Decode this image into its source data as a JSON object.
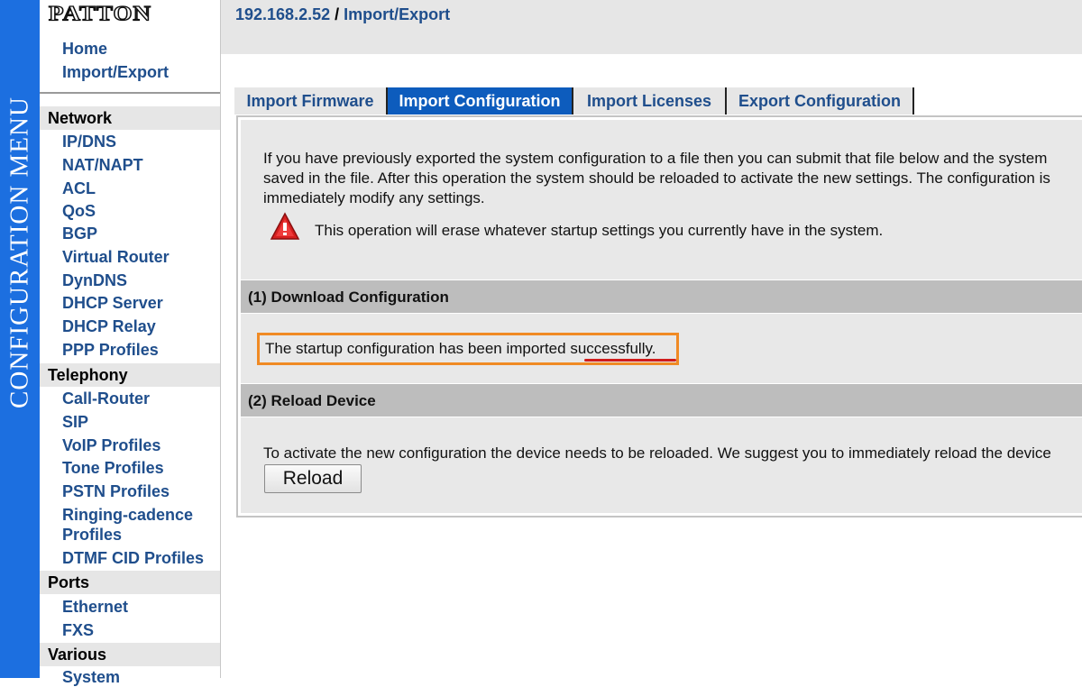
{
  "side_banner": "CONFIGURATION MENU",
  "logo": {
    "text": "PATTON"
  },
  "top_links": [
    "Home",
    "Import/Export"
  ],
  "sections": [
    {
      "title": "Network",
      "items": [
        "IP/DNS",
        "NAT/NAPT",
        "ACL",
        "QoS",
        "BGP",
        "Virtual Router",
        "DynDNS",
        "DHCP Server",
        "DHCP Relay",
        "PPP Profiles"
      ]
    },
    {
      "title": "Telephony",
      "items": [
        "Call-Router",
        "SIP",
        "VoIP Profiles",
        "Tone Profiles",
        "PSTN Profiles",
        "Ringing-cadence Profiles",
        "DTMF CID Profiles"
      ]
    },
    {
      "title": "Ports",
      "items": [
        "Ethernet",
        "FXS"
      ]
    },
    {
      "title": "Various",
      "items": [
        "System"
      ]
    }
  ],
  "breadcrumb": {
    "host": "192.168.2.52",
    "separator": " / ",
    "page": "Import/Export"
  },
  "tabs": [
    {
      "label": "Import Firmware",
      "active": false
    },
    {
      "label": "Import Configuration",
      "active": true
    },
    {
      "label": "Import Licenses",
      "active": false
    },
    {
      "label": "Export Configuration",
      "active": false
    }
  ],
  "content": {
    "intro_lines": [
      "If you have previously exported the system configuration to a file then you can submit that file below and the system",
      "saved in the file. After this operation the system should be reloaded to activate the new settings. The configuration is",
      "immediately modify any settings."
    ],
    "warning": "This operation will erase whatever startup settings you currently have in the system.",
    "section1_title": "(1) Download Configuration",
    "success_prefix": "The startup configuration has been imported ",
    "success_word": "successfully",
    "success_suffix": ".",
    "section2_title": "(2) Reload Device",
    "reload_text": "To activate the new configuration the device needs to be reloaded. We suggest you to immediately reload the device",
    "reload_button": "Reload"
  },
  "colors": {
    "side_strip": "#1c6fe0",
    "link": "#1f4e8c",
    "tab_active": "#0d5cbd",
    "highlight_box": "#f08a24",
    "underline": "#d01c1c"
  }
}
